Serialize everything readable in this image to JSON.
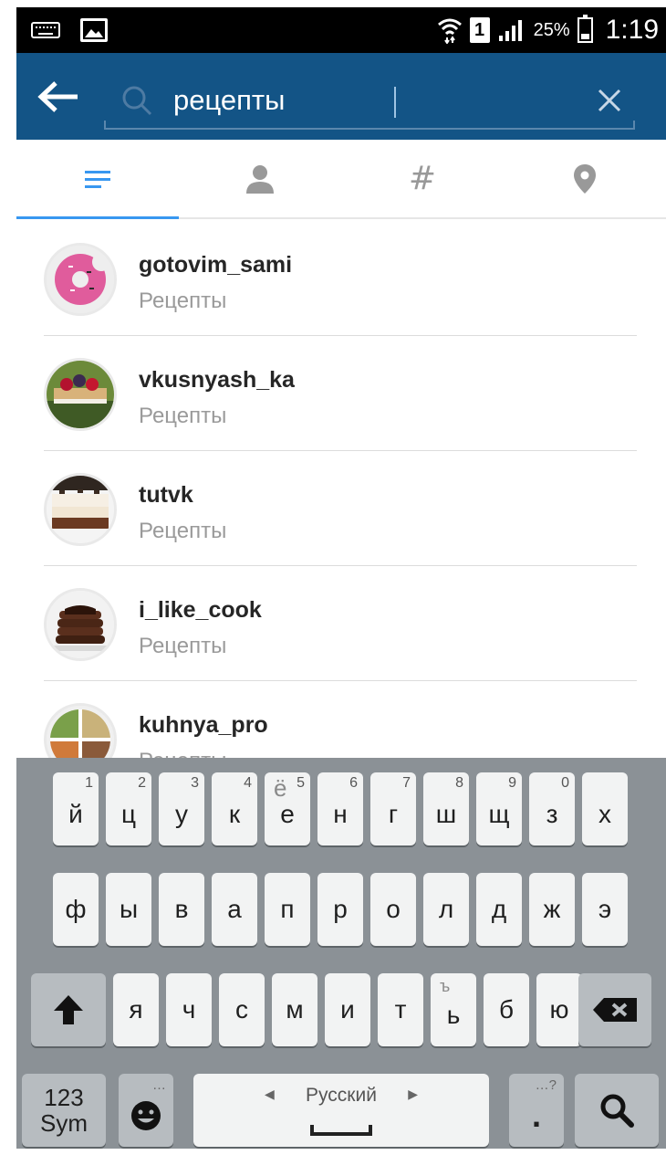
{
  "status_bar": {
    "sim_slot": "1",
    "battery_percent": "25%",
    "time": "1:19",
    "icons": [
      "keyboard-icon",
      "image-notification-icon",
      "wifi-icon",
      "signal-icon",
      "battery-icon"
    ]
  },
  "search": {
    "query": "рецепты",
    "icons": {
      "back": "arrow-left-icon",
      "search": "search-icon",
      "clear": "close-icon"
    }
  },
  "tabs": [
    {
      "id": "top",
      "icon": "list-icon",
      "active": true
    },
    {
      "id": "people",
      "icon": "person-icon",
      "active": false
    },
    {
      "id": "tags",
      "label": "#",
      "active": false
    },
    {
      "id": "places",
      "icon": "location-pin-icon",
      "active": false
    }
  ],
  "results": [
    {
      "username": "gotovim_sami",
      "full_name": "Рецепты"
    },
    {
      "username": "vkusnyash_ka",
      "full_name": "Рецепты"
    },
    {
      "username": "tutvk",
      "full_name": "Рецепты"
    },
    {
      "username": "i_like_cook",
      "full_name": "Рецепты"
    },
    {
      "username": "kuhnya_pro",
      "full_name": "Рецепты"
    }
  ],
  "keyboard": {
    "row1": [
      {
        "key": "й",
        "sup": "1"
      },
      {
        "key": "ц",
        "sup": "2"
      },
      {
        "key": "у",
        "sup": "3"
      },
      {
        "key": "к",
        "sup": "4"
      },
      {
        "key": "е",
        "sup": "5",
        "alt": "ё"
      },
      {
        "key": "н",
        "sup": "6"
      },
      {
        "key": "г",
        "sup": "7"
      },
      {
        "key": "ш",
        "sup": "8"
      },
      {
        "key": "щ",
        "sup": "9"
      },
      {
        "key": "з",
        "sup": "0"
      },
      {
        "key": "х",
        "sup": ""
      }
    ],
    "row2": [
      "ф",
      "ы",
      "в",
      "а",
      "п",
      "р",
      "о",
      "л",
      "д",
      "ж",
      "э"
    ],
    "row3": [
      {
        "key": "я"
      },
      {
        "key": "ч"
      },
      {
        "key": "с"
      },
      {
        "key": "м"
      },
      {
        "key": "и"
      },
      {
        "key": "т"
      },
      {
        "key": "ь",
        "alt": "ъ"
      },
      {
        "key": "б"
      },
      {
        "key": "ю"
      }
    ],
    "sym_line1": "123",
    "sym_line2": "Sym",
    "space_label": "Русский",
    "period": ".",
    "period_hint": "…?",
    "emoji_hint": "…",
    "icons": {
      "shift": "shift-arrow-icon",
      "backspace": "backspace-icon",
      "emoji": "smiley-icon",
      "search": "search-icon"
    }
  }
}
